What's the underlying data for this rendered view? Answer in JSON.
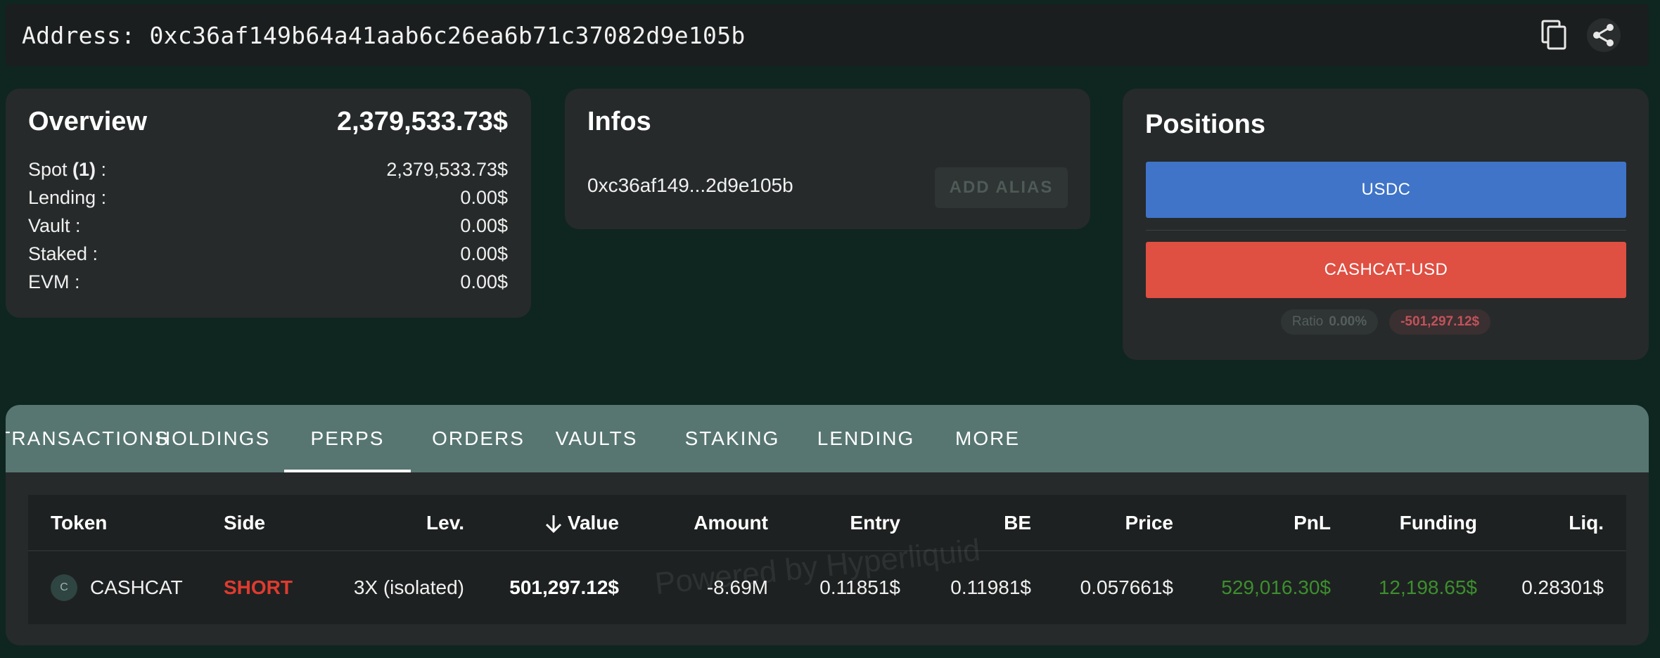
{
  "header": {
    "address_label": "Address: 0xc36af149b64a41aab6c26ea6b71c37082d9e105b",
    "copy_icon": "copy-icon",
    "share_icon": "share-icon"
  },
  "overview": {
    "title": "Overview",
    "total": "2,379,533.73$",
    "rows": [
      {
        "label_pre": "Spot ",
        "label_bold": "(1)",
        "label_post": " :",
        "value": "2,379,533.73$"
      },
      {
        "label_pre": "Lending :",
        "label_bold": "",
        "label_post": "",
        "value": "0.00$"
      },
      {
        "label_pre": "Vault :",
        "label_bold": "",
        "label_post": "",
        "value": "0.00$"
      },
      {
        "label_pre": "Staked :",
        "label_bold": "",
        "label_post": "",
        "value": "0.00$"
      },
      {
        "label_pre": "EVM :",
        "label_bold": "",
        "label_post": "",
        "value": "0.00$"
      }
    ]
  },
  "infos": {
    "title": "Infos",
    "short_address": "0xc36af149...2d9e105b",
    "add_alias_label": "ADD ALIAS"
  },
  "positions": {
    "title": "Positions",
    "usdc_label": "USDC",
    "cashcat_label": "CASHCAT-USD",
    "ratio_label": "Ratio",
    "ratio_value": "0.00%",
    "net_value": "-501,297.12$",
    "colors": {
      "usdc": "#3f74c8",
      "cashcat": "#df4f42"
    }
  },
  "tabs": [
    {
      "label": "TRANSACTIONS",
      "active": false
    },
    {
      "label": "HOLDINGS",
      "active": false
    },
    {
      "label": "PERPS",
      "active": true
    },
    {
      "label": "ORDERS",
      "active": false
    },
    {
      "label": "VAULTS",
      "active": false
    },
    {
      "label": "STAKING",
      "active": false
    },
    {
      "label": "LENDING",
      "active": false
    },
    {
      "label": "MORE",
      "active": false
    }
  ],
  "table": {
    "columns": [
      "Token",
      "Side",
      "Lev.",
      "Value",
      "Amount",
      "Entry",
      "BE",
      "Price",
      "PnL",
      "Funding",
      "Liq."
    ],
    "sort_icon": "arrow-down-icon",
    "watermark": "Powered by Hyperliquid",
    "rows": [
      {
        "token_initial": "C",
        "token": "CASHCAT",
        "side": "SHORT",
        "lev": "3X (isolated)",
        "value": "501,297.12$",
        "amount": "-8.69M",
        "entry": "0.11851$",
        "be": "0.11981$",
        "price": "0.057661$",
        "pnl": "529,016.30$",
        "funding": "12,198.65$",
        "liq": "0.28301$"
      }
    ]
  }
}
